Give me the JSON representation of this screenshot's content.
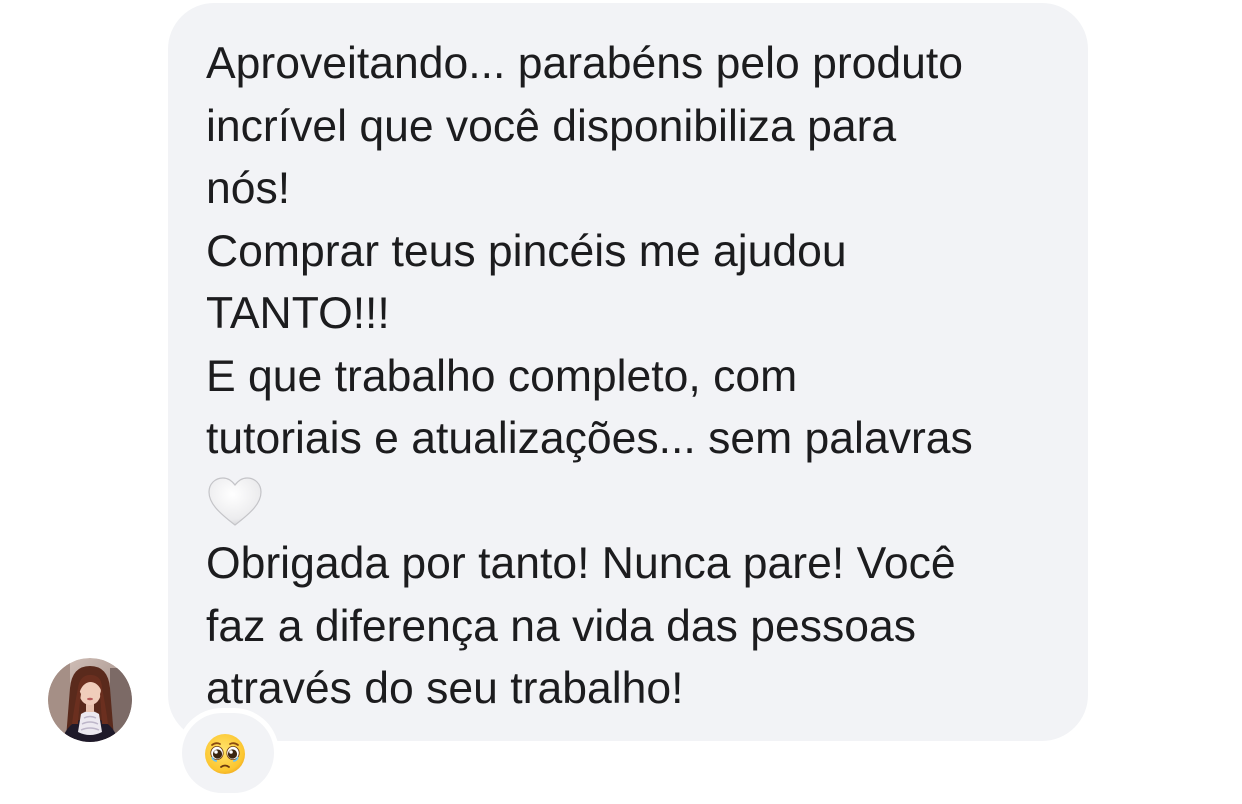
{
  "message": {
    "paragraph1": [
      "Aproveitando... parabéns pelo produto",
      "incrível que você disponibiliza para",
      "nós!"
    ],
    "paragraph2": [
      "Comprar teus pincéis me ajudou",
      "TANTO!!!"
    ],
    "paragraph3": [
      "E que trabalho completo, com",
      "tutoriais e atualizações... sem palavras"
    ],
    "paragraph3_emoji": "white-heart-emoji",
    "paragraph4": [
      "Obrigada por tanto! Nunca pare! Você",
      "faz a diferença na vida das pessoas",
      "através do seu trabalho!"
    ]
  },
  "reaction": {
    "emoji": "pleading-face-emoji"
  },
  "sender": {
    "avatar_icon": "profile-photo"
  },
  "colors": {
    "bubble": "#f2f3f6",
    "text": "#1c1c1e",
    "background": "#ffffff"
  }
}
